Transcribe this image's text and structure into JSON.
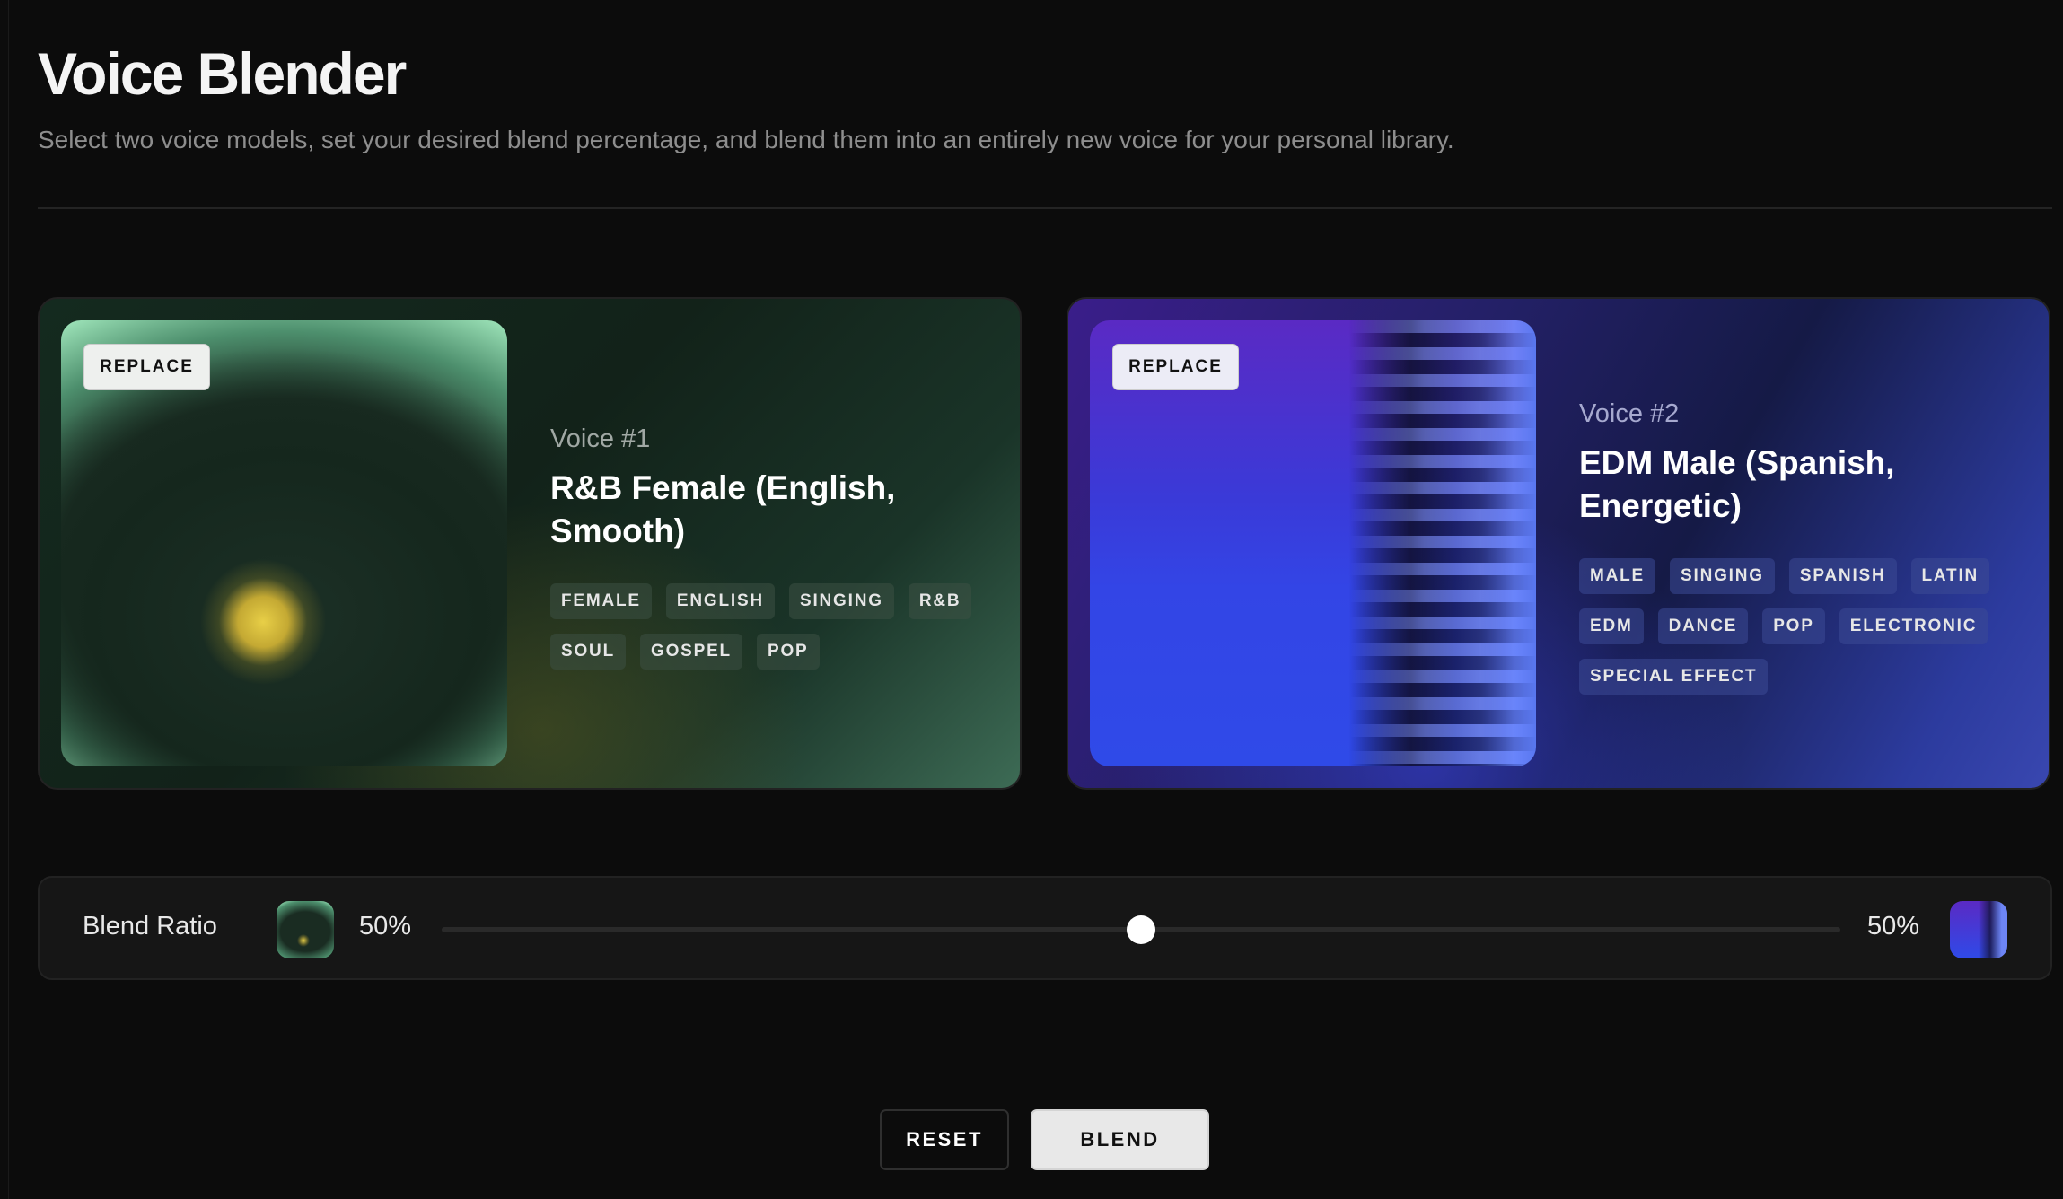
{
  "header": {
    "title": "Voice Blender",
    "subtitle": "Select two voice models, set your desired blend percentage, and blend them into an entirely new voice for your personal library."
  },
  "voices": [
    {
      "replace_label": "REPLACE",
      "label": "Voice #1",
      "name": "R&B Female (English, Smooth)",
      "tags": [
        "FEMALE",
        "ENGLISH",
        "SINGING",
        "R&B",
        "SOUL",
        "GOSPEL",
        "POP"
      ],
      "accent": "#e8cf47"
    },
    {
      "replace_label": "REPLACE",
      "label": "Voice #2",
      "name": "EDM Male (Spanish, Energetic)",
      "tags": [
        "MALE",
        "SINGING",
        "SPANISH",
        "LATIN",
        "EDM",
        "DANCE",
        "POP",
        "ELECTRONIC",
        "SPECIAL EFFECT"
      ],
      "accent": "#3345e6"
    }
  ],
  "blend": {
    "label": "Blend Ratio",
    "left_percent": "50%",
    "right_percent": "50%",
    "ratio": 0.5
  },
  "actions": {
    "reset_label": "RESET",
    "blend_label": "BLEND"
  }
}
